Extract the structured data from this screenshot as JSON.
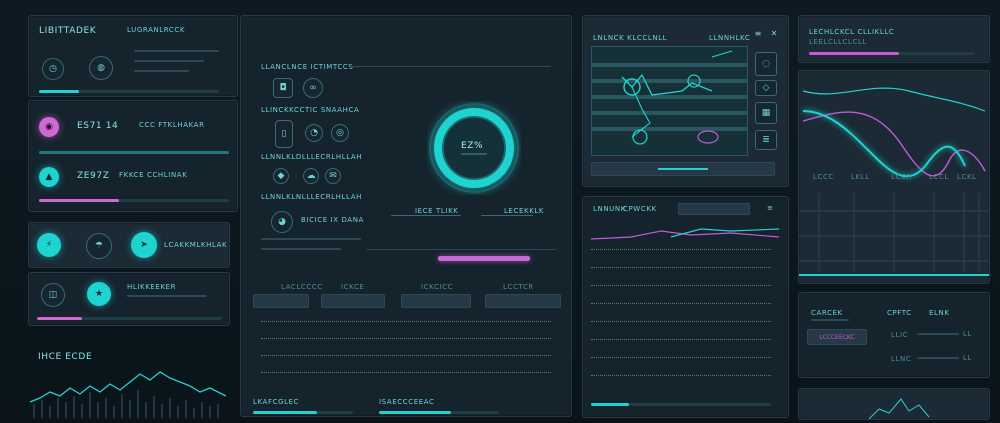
{
  "left": {
    "header": {
      "title": "LIBITTADEK",
      "subtitle": "LUGRANLRCCK"
    },
    "stat1": {
      "value": "ES71 14",
      "label": "CCC FTKLHAKAR"
    },
    "stat2": {
      "value": "ZE97Z",
      "label": "FKKCE CCHLINAK"
    },
    "toggle_label": "LCAKKMLKHLAK",
    "list_label": "HLIKKEEKER",
    "chart_title": "IHCE ECDE"
  },
  "center": {
    "rows": [
      {
        "label": "LLANCLNCE ICTIMTCCS"
      },
      {
        "label": "LLINCKKCCTIC SNAAHCA"
      },
      {
        "label": "LLNNLKLDLLLECRLHLLAH"
      },
      {
        "label": "LLNNLKLNLLLECRLHLLAH"
      }
    ],
    "user_label": "BICICE IX DANA",
    "gauge": {
      "value": "EZ%",
      "progress": 0.82
    },
    "tabs": [
      {
        "label": "IECE TLIKK"
      },
      {
        "label": "LECEKKLK"
      }
    ],
    "columns": [
      {
        "label": "LACLCCCC"
      },
      {
        "label": "ICKCE"
      },
      {
        "label": "ICKCICC"
      },
      {
        "label": "LCCTCR"
      }
    ],
    "footer": [
      {
        "label": "LKAFCGLEC"
      },
      {
        "label": "ISAECCCEEAC"
      }
    ]
  },
  "panel_c": {
    "title": "LNLNCK KLCCLNLL",
    "title2": "LLNNHLKC",
    "menu_icon": "hamburger-icon",
    "close_icon": "close-icon"
  },
  "panel_d": {
    "title": "LNNUNK",
    "title2": "CPWCKK"
  },
  "panel_e": {
    "title": "LECHLCKCL CLLIKLLC",
    "subtitle": "LEELCLLCLCLL"
  },
  "panel_f": {
    "axis_labels": [
      "LCCC",
      "LKLL",
      "LCCR",
      "LCCL",
      "LCKL"
    ],
    "legend": {
      "s1": "#24d3d0",
      "s2": "#c45ad7"
    }
  },
  "panel_g": {
    "label1": "CARCEK",
    "label2": "CPFTC",
    "label3": "ELNK",
    "button": "LCCCEECKC"
  },
  "colors": {
    "accent": "#1fd3d1",
    "pink": "#d267d6",
    "panel": "#1b2a35"
  }
}
